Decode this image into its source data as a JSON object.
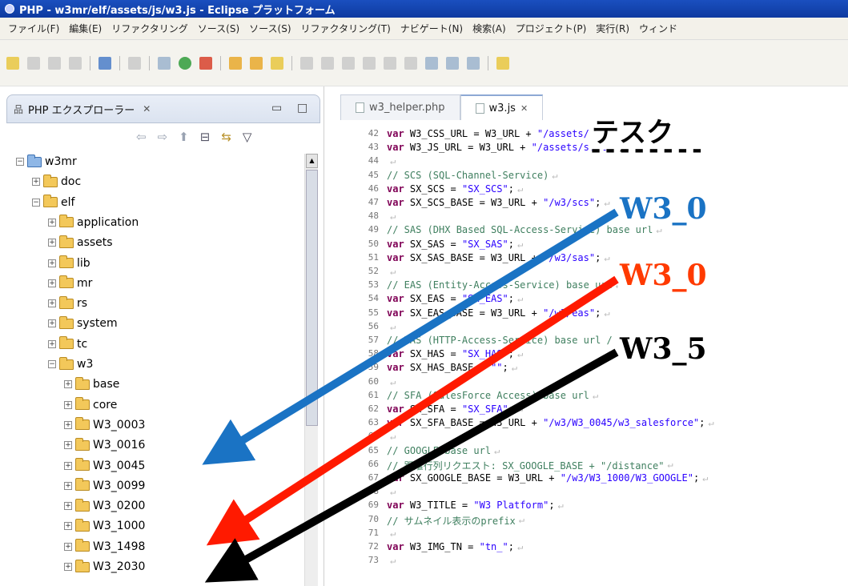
{
  "window": {
    "title": "PHP - w3mr/elf/assets/js/w3.js - Eclipse プラットフォーム"
  },
  "menubar": [
    "ファイル(F)",
    "編集(E)",
    "リファクタリング",
    "ソース(S)",
    "ソース(S)",
    "リファクタリング(T)",
    "ナビゲート(N)",
    "検索(A)",
    "プロジェクト(P)",
    "実行(R)",
    "ウィンド"
  ],
  "explorer": {
    "tab_title": "PHP エクスプローラー",
    "tree": [
      {
        "label": "w3mr",
        "depth": 0,
        "kind": "project"
      },
      {
        "label": "doc",
        "depth": 1
      },
      {
        "label": "elf",
        "depth": 1
      },
      {
        "label": "application",
        "depth": 2
      },
      {
        "label": "assets",
        "depth": 2
      },
      {
        "label": "lib",
        "depth": 2
      },
      {
        "label": "mr",
        "depth": 2
      },
      {
        "label": "rs",
        "depth": 2
      },
      {
        "label": "system",
        "depth": 2
      },
      {
        "label": "tc",
        "depth": 2
      },
      {
        "label": "w3",
        "depth": 2
      },
      {
        "label": "base",
        "depth": 3
      },
      {
        "label": "core",
        "depth": 3
      },
      {
        "label": "W3_0003",
        "depth": 3
      },
      {
        "label": "W3_0016",
        "depth": 3
      },
      {
        "label": "W3_0045",
        "depth": 3
      },
      {
        "label": "W3_0099",
        "depth": 3
      },
      {
        "label": "W3_0200",
        "depth": 3
      },
      {
        "label": "W3_1000",
        "depth": 3
      },
      {
        "label": "W3_1498",
        "depth": 3
      },
      {
        "label": "W3_2030",
        "depth": 3
      }
    ]
  },
  "editor": {
    "tabs": [
      "w3_helper.php",
      "w3.js"
    ],
    "active_tab": "w3.js",
    "lines": [
      {
        "n": "42",
        "parts": [
          [
            "kw",
            "var"
          ],
          [
            "t",
            " W3_CSS_URL = W3_URL + "
          ],
          [
            "str",
            "\"/assets/css\""
          ],
          [
            "t",
            ";"
          ]
        ]
      },
      {
        "n": "43",
        "parts": [
          [
            "kw",
            "var"
          ],
          [
            "t",
            " W3_JS_URL = W3_URL + "
          ],
          [
            "str",
            "\"/assets/style\""
          ],
          [
            "t",
            ";"
          ]
        ]
      },
      {
        "n": "44",
        "parts": []
      },
      {
        "n": "45",
        "parts": [
          [
            "cm",
            "// SCS (SQL-Channel-Service)"
          ]
        ]
      },
      {
        "n": "46",
        "parts": [
          [
            "kw",
            "var"
          ],
          [
            "t",
            " SX_SCS = "
          ],
          [
            "str",
            "\"SX_SCS\""
          ],
          [
            "t",
            ";"
          ]
        ]
      },
      {
        "n": "47",
        "parts": [
          [
            "kw",
            "var"
          ],
          [
            "t",
            " SX_SCS_BASE = W3_URL + "
          ],
          [
            "str",
            "\"/w3/scs\""
          ],
          [
            "t",
            ";"
          ]
        ]
      },
      {
        "n": "48",
        "parts": []
      },
      {
        "n": "49",
        "parts": [
          [
            "cm",
            "// SAS (DHX Based SQL-Access-Service) base url"
          ]
        ]
      },
      {
        "n": "50",
        "parts": [
          [
            "kw",
            "var"
          ],
          [
            "t",
            " SX_SAS = "
          ],
          [
            "str",
            "\"SX_SAS\""
          ],
          [
            "t",
            ";"
          ]
        ]
      },
      {
        "n": "51",
        "parts": [
          [
            "kw",
            "var"
          ],
          [
            "t",
            " SX_SAS_BASE = W3_URL + "
          ],
          [
            "str",
            "\"/w3/sas\""
          ],
          [
            "t",
            ";"
          ]
        ]
      },
      {
        "n": "52",
        "parts": []
      },
      {
        "n": "53",
        "parts": [
          [
            "cm",
            "// EAS (Entity-Access-Service) base url"
          ]
        ]
      },
      {
        "n": "54",
        "parts": [
          [
            "kw",
            "var"
          ],
          [
            "t",
            " SX_EAS = "
          ],
          [
            "str",
            "\"SX_EAS\""
          ],
          [
            "t",
            ";"
          ]
        ]
      },
      {
        "n": "55",
        "parts": [
          [
            "kw",
            "var"
          ],
          [
            "t",
            " SX_EAS_BASE = W3_URL + "
          ],
          [
            "str",
            "\"/w3/eas\""
          ],
          [
            "t",
            ";"
          ]
        ]
      },
      {
        "n": "56",
        "parts": []
      },
      {
        "n": "57",
        "parts": [
          [
            "cm",
            "// HAS (HTTP-Access-Service) base url / any url"
          ]
        ]
      },
      {
        "n": "58",
        "parts": [
          [
            "kw",
            "var"
          ],
          [
            "t",
            " SX_HAS = "
          ],
          [
            "str",
            "\"SX_HAS\""
          ],
          [
            "t",
            ";"
          ]
        ]
      },
      {
        "n": "59",
        "parts": [
          [
            "kw",
            "var"
          ],
          [
            "t",
            " SX_HAS_BASE = "
          ],
          [
            "str",
            "\"\""
          ],
          [
            "t",
            ";"
          ]
        ]
      },
      {
        "n": "60",
        "parts": []
      },
      {
        "n": "61",
        "parts": [
          [
            "cm",
            "// SFA (SalesForce Access) base url"
          ]
        ]
      },
      {
        "n": "62",
        "parts": [
          [
            "kw",
            "var"
          ],
          [
            "t",
            " SX_SFA = "
          ],
          [
            "str",
            "\"SX_SFA\""
          ],
          [
            "t",
            ";"
          ]
        ]
      },
      {
        "n": "63",
        "parts": [
          [
            "kw",
            "var"
          ],
          [
            "t",
            " SX_SFA_BASE = W3_URL + "
          ],
          [
            "str",
            "\"/w3/W3_0045/w3_salesforce\""
          ],
          [
            "t",
            ";"
          ]
        ]
      },
      {
        "n": "64",
        "parts": []
      },
      {
        "n": "65",
        "parts": [
          [
            "cm",
            "// GOOGLE base url"
          ]
        ]
      },
      {
        "n": "66",
        "parts": [
          [
            "cm",
            "// 距離行列リクエスト: SX_GOOGLE_BASE + \"/distance\""
          ]
        ]
      },
      {
        "n": "67",
        "parts": [
          [
            "kw",
            "var"
          ],
          [
            "t",
            " SX_GOOGLE_BASE = W3_URL + "
          ],
          [
            "str",
            "\"/w3/W3_1000/W3_GOOGLE\""
          ],
          [
            "t",
            ";"
          ]
        ]
      },
      {
        "n": "68",
        "parts": []
      },
      {
        "n": "69",
        "parts": [
          [
            "kw",
            "var"
          ],
          [
            "t",
            " W3_TITLE = "
          ],
          [
            "str",
            "\"W3 Platform\""
          ],
          [
            "t",
            ";"
          ]
        ]
      },
      {
        "n": "70",
        "parts": [
          [
            "cm",
            "// サムネイル表示のprefix"
          ]
        ]
      },
      {
        "n": "71",
        "parts": []
      },
      {
        "n": "72",
        "parts": [
          [
            "kw",
            "var"
          ],
          [
            "t",
            " W3_IMG_TN = "
          ],
          [
            "str",
            "\"tn_\""
          ],
          [
            "t",
            ";"
          ]
        ]
      },
      {
        "n": "73",
        "parts": []
      }
    ]
  },
  "overlay": {
    "title": "テスク",
    "dashes": "--------",
    "labels": [
      "W3_0",
      "W3_0",
      "W3_5"
    ]
  },
  "colors": {
    "blue": "#1a73c4",
    "red": "#ff1a00",
    "black": "#000000"
  }
}
